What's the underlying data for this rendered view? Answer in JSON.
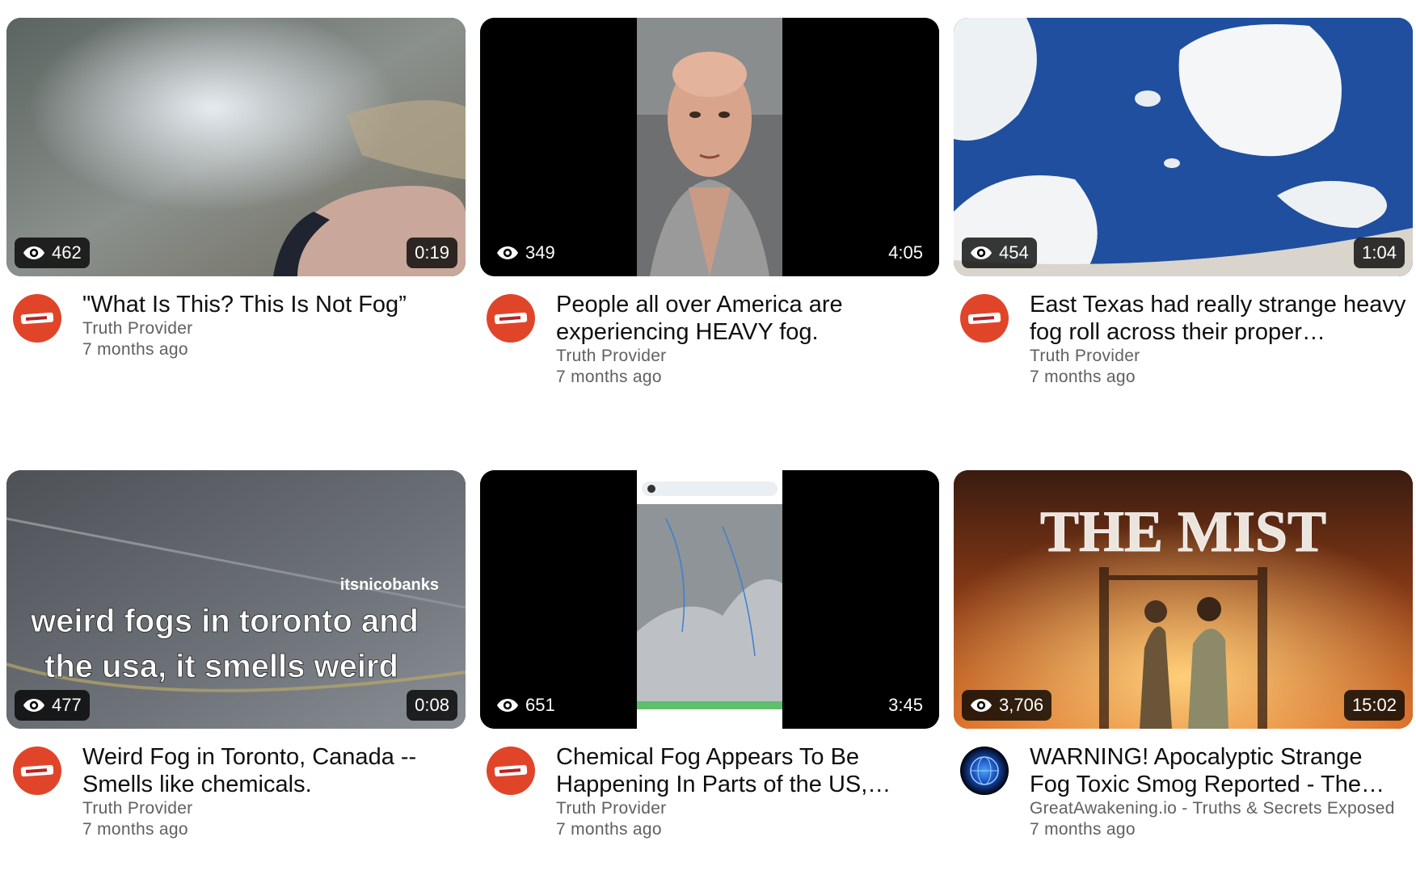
{
  "videos": [
    {
      "title": "\"What Is This? This Is Not Fog”",
      "channel": "Truth Provider",
      "age": "7 months ago",
      "views": "462",
      "duration": "0:19",
      "avatar": "truth-provider-logo"
    },
    {
      "title": "People all over America are experiencing HEAVY fog.",
      "channel": "Truth Provider",
      "age": "7 months ago",
      "views": "349",
      "duration": "4:05",
      "avatar": "truth-provider-logo"
    },
    {
      "title": "East Texas had really strange heavy fog roll across their proper…",
      "channel": "Truth Provider",
      "age": "7 months ago",
      "views": "454",
      "duration": "1:04",
      "avatar": "truth-provider-logo"
    },
    {
      "title": "Weird Fog in Toronto, Canada -- Smells like chemicals.",
      "channel": "Truth Provider",
      "age": "7 months ago",
      "views": "477",
      "duration": "0:08",
      "avatar": "truth-provider-logo",
      "thumb_handle": "itsnicobanks",
      "thumb_caption_1": "weird fogs in toronto and",
      "thumb_caption_2": "the usa, it smells weird"
    },
    {
      "title": "Chemical Fog Appears To Be Happening In Parts of the US,…",
      "channel": "Truth Provider",
      "age": "7 months ago",
      "views": "651",
      "duration": "3:45",
      "avatar": "truth-provider-logo"
    },
    {
      "title": "WARNING! Apocalyptic Strange Fog Toxic Smog Reported - The…",
      "channel": "GreatAwakening.io - Truths & Secrets Exposed",
      "age": "7 months ago",
      "views": "3,706",
      "duration": "15:02",
      "avatar": "great-awakening-globe-logo",
      "thumb_title": "THE MIST"
    }
  ],
  "colors": {
    "text_primary": "#0f0f0f",
    "text_secondary": "#606060",
    "overlay": "#000000",
    "truth_avatar": "#e0452a"
  }
}
